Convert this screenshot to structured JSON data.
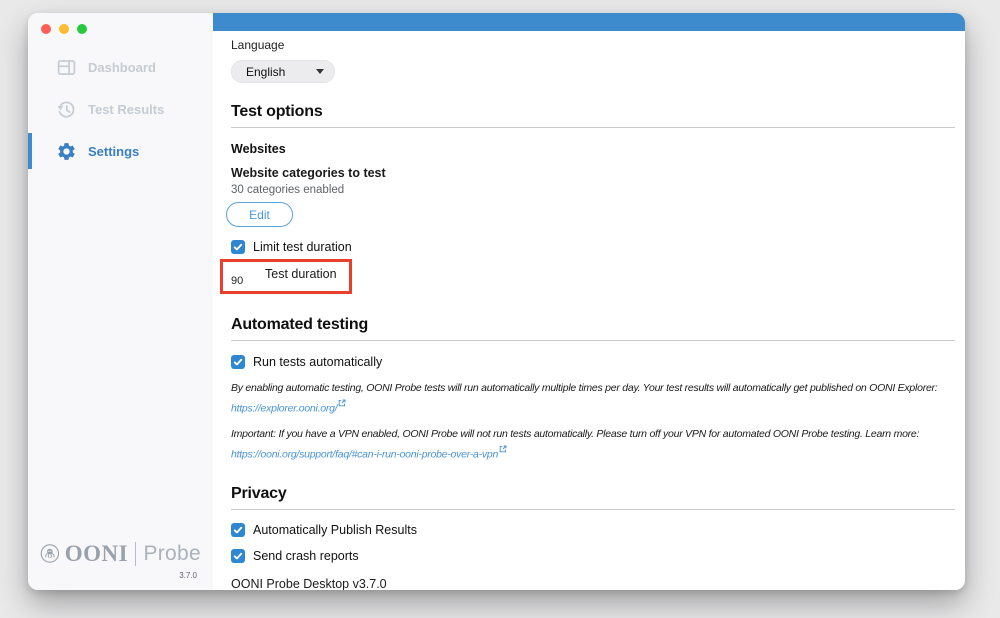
{
  "colors": {
    "accent_blue": "#3d8bcc",
    "link_blue": "#4893d6",
    "annotation_red": "#e8402a",
    "checkbox_blue": "#2f87cf",
    "traffic_red": "#ff5f57",
    "traffic_yellow": "#febc2e",
    "traffic_green": "#28c840"
  },
  "sidebar": {
    "items": [
      {
        "label": "Dashboard",
        "icon": "dashboard-icon",
        "active": false
      },
      {
        "label": "Test Results",
        "icon": "history-icon",
        "active": false
      },
      {
        "label": "Settings",
        "icon": "gear-icon",
        "active": true
      }
    ],
    "logo": {
      "icon": "octopus-icon",
      "brand": "OONI",
      "product": "Probe",
      "version": "3.7.0"
    }
  },
  "main": {
    "language": {
      "label": "Language",
      "selected_option": "English"
    },
    "test_options": {
      "heading": "Test options",
      "group_label": "Websites",
      "categories_title": "Website categories to test",
      "categories_status": "30 categories enabled",
      "edit_button": "Edit",
      "limit_checkbox_label": "Limit test duration",
      "duration_field": {
        "value": "90",
        "label": "Test duration"
      }
    },
    "automated_testing": {
      "heading": "Automated testing",
      "run_checkbox_label": "Run tests automatically",
      "info_text": "By enabling automatic testing, OONI Probe tests will run automatically multiple times per day. Your test results will automatically get published on OONI Explorer:",
      "info_link": "https://explorer.ooni.org/",
      "vpn_text": "Important: If you have a VPN enabled, OONI Probe will not run tests automatically. Please turn off your VPN for automated OONI Probe testing. Learn more:",
      "vpn_link": "https://ooni.org/support/faq/#can-i-run-ooni-probe-over-a-vpn"
    },
    "privacy": {
      "heading": "Privacy",
      "publish_checkbox_label": "Automatically Publish Results",
      "crash_checkbox_label": "Send crash reports",
      "app_version_line": "OONI Probe Desktop v3.7.0"
    }
  }
}
